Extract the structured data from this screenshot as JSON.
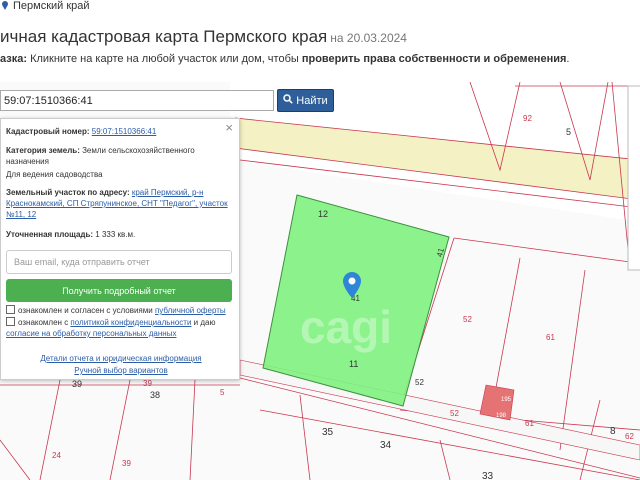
{
  "header": {
    "region": "Пермский край",
    "title": "ичная кадастровая карта Пермского края",
    "date": "на 20.03.2024",
    "hint_prefix": "азка:",
    "hint_text": " Кликните на карте на любой участок или дом, чтобы ",
    "hint_bold": "проверить права собственности и обременения",
    "hint_end": "."
  },
  "search": {
    "value": "59:07:1510366:41",
    "button_label": "Найти"
  },
  "card": {
    "cadastral_label": "Кадастровый номер:",
    "cadastral_value": "59:07:1510366:41",
    "category_label": "Категория земель:",
    "category_value": "Земли сельскохозяйственного назначения",
    "usage": "Для ведения садоводства",
    "address_label": "Земельный участок по адресу:",
    "address_value": "край Пермский, р-н Краснокамский, СП Стряпунинское, СНТ \"Педагог\", участок №11, 12",
    "area_label": "Уточненная площадь:",
    "area_value": "1 333 кв.м.",
    "email_placeholder": "Ваш email, куда отправить отчет",
    "report_button": "Получить подробный отчет",
    "consent1_text": "ознакомлен и согласен с условиями ",
    "consent1_link": "публичной оферты",
    "consent2_text": "ознакомлен с ",
    "consent2_link1": "политикой конфиденциальности",
    "consent2_mid": " и даю ",
    "consent2_link2": "согласие на обработку персональных данных",
    "details_link": "Детали отчета и юридическая информация",
    "manual_link": "Ручной выбор вариантов"
  },
  "map": {
    "watermark": "cagi",
    "labels": [
      "92",
      "5",
      "12",
      "41",
      "41",
      "52",
      "61",
      "11",
      "52",
      "52",
      "39",
      "39",
      "38",
      "5",
      "35",
      "34",
      "61",
      "8",
      "62",
      "24",
      "39",
      "33",
      "195",
      "198"
    ],
    "colors": {
      "selected_parcel": "#7ff27f",
      "road": "#f4f1c4",
      "boundary": "#c9374f",
      "pin": "#2f86d6"
    }
  }
}
